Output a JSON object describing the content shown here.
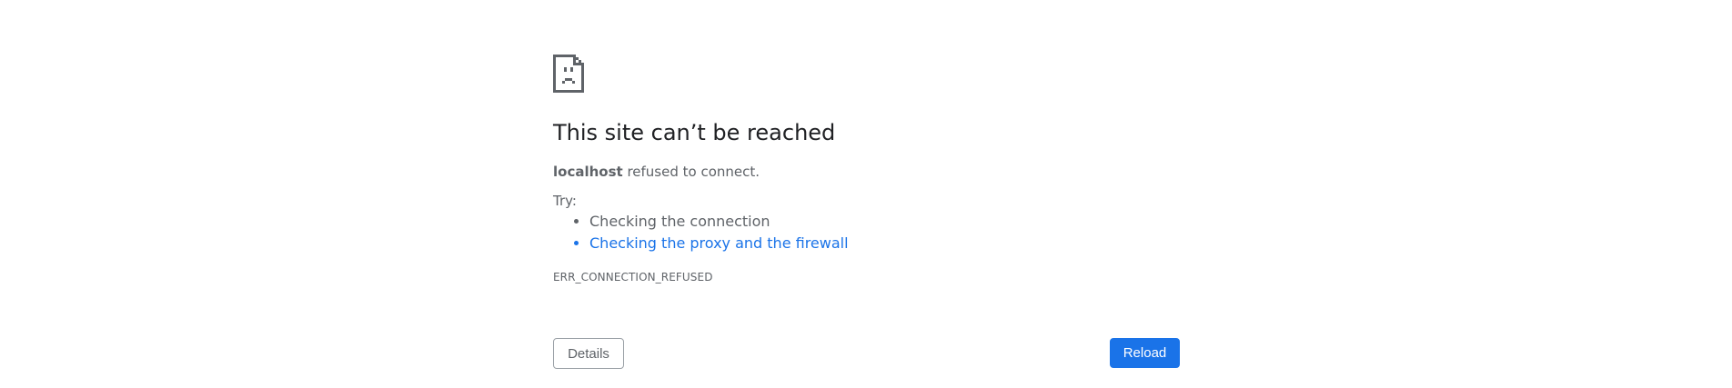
{
  "error_page": {
    "title": "This site can’t be reached",
    "host": "localhost",
    "summary_suffix": " refused to connect.",
    "try_label": "Try:",
    "suggestions": [
      "Checking the connection",
      "Checking the proxy and the firewall"
    ],
    "error_code": "ERR_CONNECTION_REFUSED",
    "details_label": "Details",
    "reload_label": "Reload",
    "icon": "sad-page-icon"
  },
  "colors": {
    "title": "#202124",
    "text": "#5f6368",
    "link": "#1a73e8",
    "primary_button": "#1a73e8"
  }
}
